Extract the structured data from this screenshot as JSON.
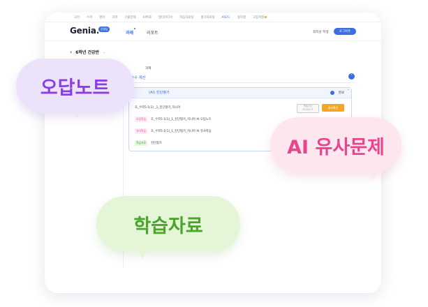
{
  "topnav": {
    "items": [
      "국어",
      "수학",
      "영어",
      "과학",
      "기출문제",
      "AI특화",
      "멀티미디어",
      "학습자료실",
      "평가자료실",
      "AI모드",
      "중학생",
      "고등학생"
    ],
    "active_index": 9
  },
  "header": {
    "logo": "Genia.",
    "logo_badge": "선생님",
    "tabs": [
      "과제",
      "리포트"
    ],
    "user_name": "최지윤 학생",
    "logout_label": "로그아웃"
  },
  "page": {
    "back_title": "6학년 건강반",
    "top_small": "과제",
    "section_title": "1 분수 계산",
    "box_title": "(AI) 진단평가",
    "box_status": "완료",
    "rows": [
      {
        "tag": "",
        "text": "초_수학5-1(1) _1_진단평가_지니아"
      },
      {
        "tag": "오답학습",
        "text": "초_수학5-1(1)_1_진단평가_지니아 AI 오답노트"
      },
      {
        "tag": "유사학습",
        "text": "초_수학5-1(1)_1_진단평가_지니아 AI 유사학습"
      },
      {
        "tag": "학습자료",
        "text": "진단평가"
      }
    ],
    "btn_grey_1": "학습기간",
    "btn_grey_2": "23.03.13",
    "btn_orange": "결과확인"
  },
  "bubbles": {
    "wrong_note": "오답노트",
    "ai_similar": "AI 유사문제",
    "materials": "학습자료"
  },
  "colors": {
    "accent": "#3b6fe0",
    "purple": "#8a3fe1",
    "pink": "#e7468e",
    "green": "#4aa52a",
    "orange": "#f5a623"
  }
}
